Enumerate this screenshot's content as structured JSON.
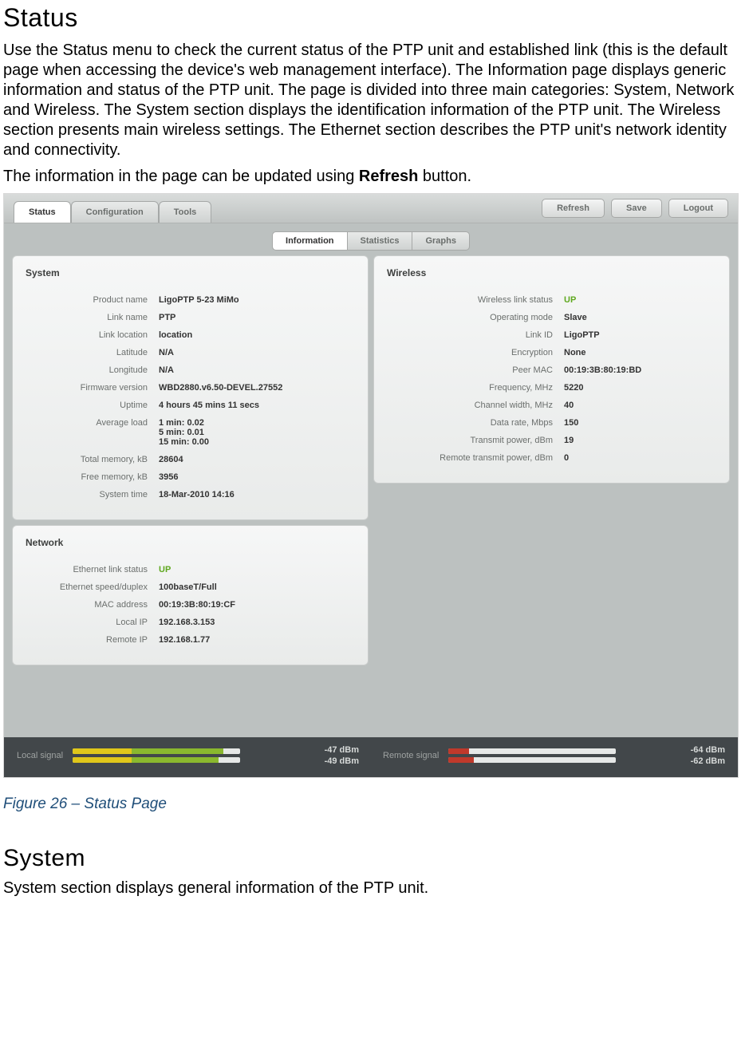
{
  "doc": {
    "heading_status": "Status",
    "paragraph1": "Use the Status menu to check the current status of the PTP unit and established link (this is the default page when accessing the device's web management interface). The Information page displays generic information and status of the PTP unit. The page is divided into three main categories: System, Network and Wireless. The System section displays the identification information of the PTP unit. The Wireless section presents main wireless settings. The Ethernet section describes the PTP unit's network identity and connectivity.",
    "paragraph2_pre": "The information in the page can be updated using ",
    "paragraph2_bold": "Refresh",
    "paragraph2_post": " button.",
    "figure_caption": "Figure 26 – Status Page",
    "heading_system": "System",
    "paragraph3": "System section displays general information of the PTP unit."
  },
  "ui": {
    "main_tabs": {
      "status": "Status",
      "configuration": "Configuration",
      "tools": "Tools"
    },
    "buttons": {
      "refresh": "Refresh",
      "save": "Save",
      "logout": "Logout"
    },
    "sub_tabs": {
      "information": "Information",
      "statistics": "Statistics",
      "graphs": "Graphs"
    },
    "panels": {
      "system": {
        "title": "System",
        "rows": {
          "product_name": {
            "label": "Product name",
            "value": "LigoPTP 5-23 MiMo"
          },
          "link_name": {
            "label": "Link name",
            "value": "PTP"
          },
          "link_location": {
            "label": "Link location",
            "value": "location"
          },
          "latitude": {
            "label": "Latitude",
            "value": "N/A"
          },
          "longitude": {
            "label": "Longitude",
            "value": "N/A"
          },
          "firmware": {
            "label": "Firmware version",
            "value": "WBD2880.v6.50-DEVEL.27552"
          },
          "uptime": {
            "label": "Uptime",
            "value": "4 hours 45 mins 11 secs"
          },
          "avg_load": {
            "label": "Average load",
            "value": "1 min:  0.02\n5 min:  0.01\n15 min: 0.00"
          },
          "total_mem": {
            "label": "Total memory, kB",
            "value": "28604"
          },
          "free_mem": {
            "label": "Free memory, kB",
            "value": "3956"
          },
          "system_time": {
            "label": "System time",
            "value": "18-Mar-2010 14:16"
          }
        }
      },
      "network": {
        "title": "Network",
        "rows": {
          "eth_status": {
            "label": "Ethernet link status",
            "value": "UP"
          },
          "eth_speed": {
            "label": "Ethernet speed/duplex",
            "value": "100baseT/Full"
          },
          "mac": {
            "label": "MAC address",
            "value": "00:19:3B:80:19:CF"
          },
          "local_ip": {
            "label": "Local IP",
            "value": "192.168.3.153"
          },
          "remote_ip": {
            "label": "Remote IP",
            "value": "192.168.1.77"
          }
        }
      },
      "wireless": {
        "title": "Wireless",
        "rows": {
          "wlink_status": {
            "label": "Wireless link status",
            "value": "UP"
          },
          "op_mode": {
            "label": "Operating mode",
            "value": "Slave"
          },
          "link_id": {
            "label": "Link ID",
            "value": "LigoPTP"
          },
          "encryption": {
            "label": "Encryption",
            "value": "None"
          },
          "peer_mac": {
            "label": "Peer MAC",
            "value": "00:19:3B:80:19:BD"
          },
          "frequency": {
            "label": "Frequency, MHz",
            "value": "5220"
          },
          "chan_width": {
            "label": "Channel width, MHz",
            "value": "40"
          },
          "data_rate": {
            "label": "Data rate, Mbps",
            "value": "150"
          },
          "tx_power": {
            "label": "Transmit power, dBm",
            "value": "19"
          },
          "remote_tx": {
            "label": "Remote transmit power, dBm",
            "value": "0"
          }
        }
      }
    },
    "signal": {
      "local_label": "Local signal",
      "local_values": [
        "-47 dBm",
        "-49 dBm"
      ],
      "remote_label": "Remote signal",
      "remote_values": [
        "-64 dBm",
        "-62 dBm"
      ]
    }
  }
}
